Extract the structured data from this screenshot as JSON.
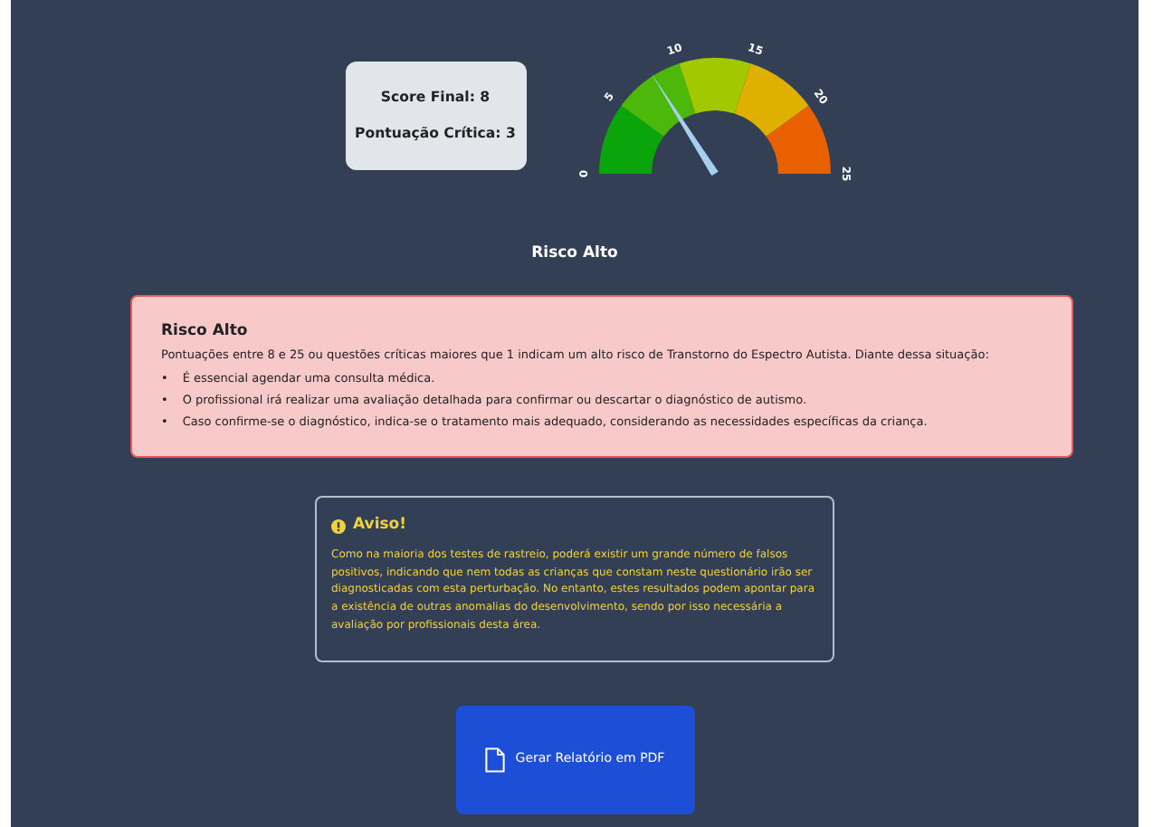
{
  "summary": {
    "score_label": "Score Final: 8",
    "critical_label": "Pontuação Crítica: 3"
  },
  "gauge": {
    "level": 0.32,
    "segments": [
      {
        "color": "#0aa50a"
      },
      {
        "color": "#4cb80a"
      },
      {
        "color": "#a2c800"
      },
      {
        "color": "#e0b000"
      },
      {
        "color": "#e86000"
      }
    ],
    "ticks": [
      "0",
      "5",
      "10",
      "15",
      "20",
      "25"
    ]
  },
  "risk_label": "Risco Alto",
  "alert": {
    "title": "Risco Alto",
    "text": "Pontuações entre 8 e 25 ou questões críticas maiores que 1 indicam um alto risco de Transtorno do Espectro Autista. Diante dessa situação:",
    "items": [
      {
        "bullet": "•",
        "text": "É essencial agendar uma consulta médica."
      },
      {
        "bullet": "•",
        "text": "O profissional irá realizar uma avaliação detalhada para confirmar ou descartar o diagnóstico de autismo."
      },
      {
        "bullet": "•",
        "text": "Caso confirme-se o diagnóstico, indica-se o tratamento mais adequado, considerando as necessidades específicas da criança."
      }
    ]
  },
  "warning": {
    "title": "Aviso!",
    "text": "Como na maioria dos testes de rastreio, poderá existir um grande número de falsos positivos, indicando que nem todas as crianças que constam neste questionário irão ser diagnosticadas com esta perturbação. No entanto, estes resultados podem apontar para a existência de outras anomalias do desenvolvimento, sendo por isso necessária a avaliação por profissionais desta área."
  },
  "report_button": {
    "label": "Gerar Relatório em PDF"
  }
}
